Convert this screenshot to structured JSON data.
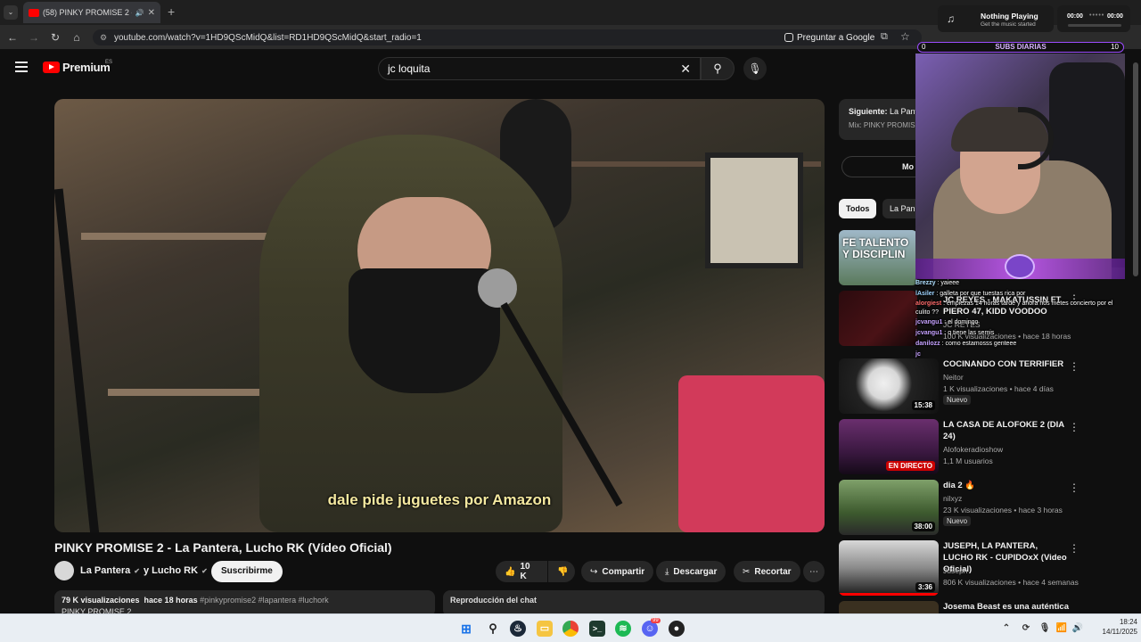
{
  "browser": {
    "tab_title": "(58) PINKY PROMISE 2 - La",
    "url": "youtube.com/watch?v=1HD9QScMidQ&list=RD1HD9QScMidQ&start_radio=1",
    "ask_google": "Preguntar a Google"
  },
  "now_playing": {
    "title": "Nothing Playing",
    "subtitle": "Get the music started",
    "time_start": "00:00",
    "time_end": "00:00"
  },
  "yt": {
    "logo": "Premium",
    "region": "ES",
    "search_value": "jc loquita"
  },
  "video": {
    "caption": "dale pide juguetes por Amazon",
    "title": "PINKY PROMISE 2 - La Pantera, Lucho RK (Vídeo Oficial)",
    "channel": "La Pantera",
    "channel_joiner": "y Lucho RK",
    "subscribe": "Suscribirme",
    "likes": "10 K",
    "share": "Compartir",
    "download": "Descargar",
    "clip": "Recortar",
    "stats": "79 K visualizaciones  hace 18 horas",
    "tags": "#pinkypromise2 #lapantera #luchork",
    "desc_line": "PINKY PROMISE 2",
    "chat_replay": "Reproducción del chat"
  },
  "sidebar": {
    "next_label": "Siguiente:",
    "next_value": "La Pant",
    "mix": "Mix: PINKY PROMISE",
    "more_btn": "Mo",
    "chip_all": "Todos",
    "chip_2": "La Pan",
    "recs": [
      {
        "title": "",
        "channel": "",
        "meta": "",
        "badge": "",
        "duration": ""
      },
      {
        "title": "JC REYES - MAKATUSSIN FT PIERO 47, KIDD VOODOO",
        "channel": "JC REYES",
        "meta": "100 K visualizaciones • hace 18 horas",
        "badge": "",
        "duration": ""
      },
      {
        "title": "COCINANDO CON TERRIFIER",
        "channel": "Neitor",
        "meta": "1 K visualizaciones • hace 4 días",
        "badge": "Nuevo",
        "duration": "15:38"
      },
      {
        "title": "LA CASA DE ALOFOKE 2 (DIA 24)",
        "channel": "Alofokeradioshow",
        "meta": "1,1 M usuarios",
        "badge": "",
        "duration": "EN DIRECTO"
      },
      {
        "title": "dia 2 🔥",
        "channel": "nilxyz",
        "meta": "23 K visualizaciones • hace 3 horas",
        "badge": "Nuevo",
        "duration": "38:00"
      },
      {
        "title": "JUSEPH, LA PANTERA, LUCHO RK - CUPIDOxX (Video Oficial)",
        "channel": "Juseph",
        "meta": "806 K visualizaciones • hace 4 semanas",
        "badge": "",
        "duration": "3:36"
      },
      {
        "title": "Josema Beast es una auténtica",
        "channel": "",
        "meta": "",
        "badge": "",
        "duration": ""
      }
    ],
    "thumb1_text": "FE TALENTO Y DISCIPLIN"
  },
  "overlay": {
    "subs_label": "SUBS DIARIAS",
    "subs_min": "0",
    "subs_max": "10",
    "chat": [
      {
        "user": "Brezzy",
        "msg": "yaieee"
      },
      {
        "user": "lAsiler",
        "msg": "galleta por que tuestas rica por"
      },
      {
        "user": "alorgiest",
        "msg": "empiezas 14 horas tarde y ahora nos metes concierto por el culito ??"
      },
      {
        "user": "jcvangu1",
        "msg": "el domingo"
      },
      {
        "user": "jcvangu1",
        "msg": "q tiene las semis"
      },
      {
        "user": "danilozz",
        "msg": "como estamosss genteee"
      },
      {
        "user": "jc",
        "msg": ""
      }
    ]
  },
  "taskbar": {
    "time": "18:24",
    "date": "14/11/2025",
    "discord_badge": "99"
  }
}
